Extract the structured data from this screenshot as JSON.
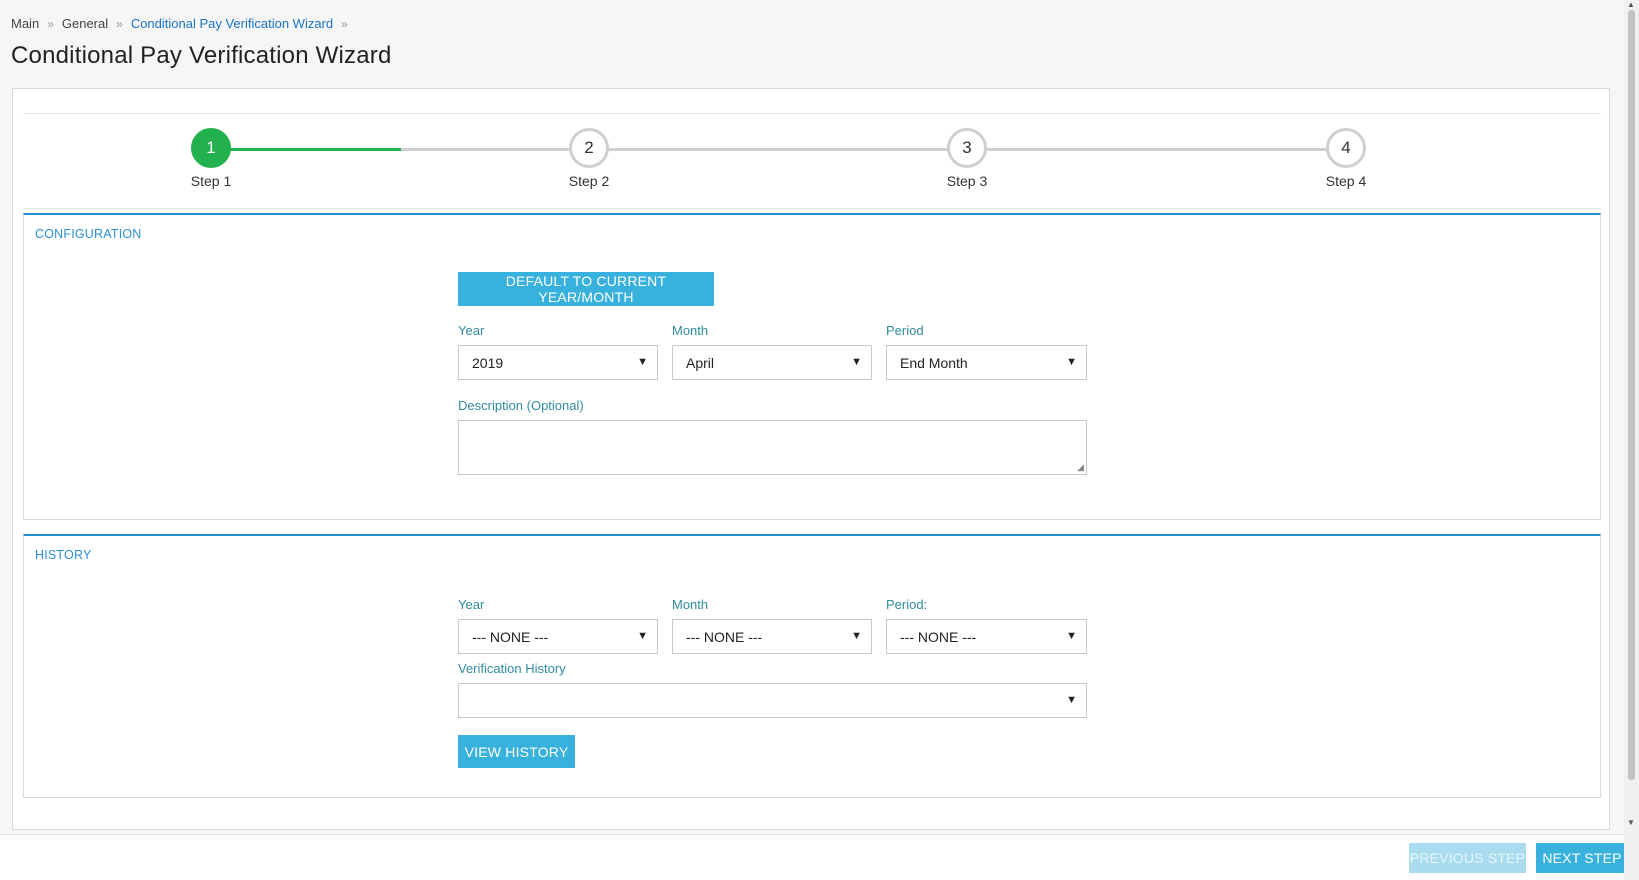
{
  "breadcrumb": [
    {
      "label": "Main"
    },
    {
      "label": "General"
    },
    {
      "label": "Conditional Pay Verification Wizard"
    }
  ],
  "page_title": "Conditional Pay Verification Wizard",
  "stepper": {
    "steps": [
      {
        "number": "1",
        "label": "Step 1",
        "active": true
      },
      {
        "number": "2",
        "label": "Step 2",
        "active": false
      },
      {
        "number": "3",
        "label": "Step 3",
        "active": false
      },
      {
        "number": "4",
        "label": "Step 4",
        "active": false
      }
    ],
    "active_color": "#22b14c"
  },
  "configuration": {
    "title": "CONFIGURATION",
    "default_button": "DEFAULT TO CURRENT YEAR/MONTH",
    "year_label": "Year",
    "year_value": "2019",
    "month_label": "Month",
    "month_value": "April",
    "period_label": "Period",
    "period_value": "End Month",
    "description_label": "Description (Optional)",
    "description_value": ""
  },
  "history": {
    "title": "HISTORY",
    "year_label": "Year",
    "year_value": "--- NONE ---",
    "month_label": "Month",
    "month_value": "--- NONE ---",
    "period_label": "Period:",
    "period_value": "--- NONE ---",
    "verification_label": "Verification History",
    "verification_value": "",
    "view_button": "VIEW HISTORY"
  },
  "footer": {
    "previous_button": "PREVIOUS STEP",
    "next_button": "NEXT STEP"
  },
  "icons": {
    "breadcrumb_separator": "chevron-double-right-icon",
    "dropdown": "caret-down-icon"
  },
  "colors": {
    "accent": "#38b1dd",
    "section_border": "#2b8fd6",
    "label": "#2f8c9e",
    "step_done": "#22b14c"
  }
}
